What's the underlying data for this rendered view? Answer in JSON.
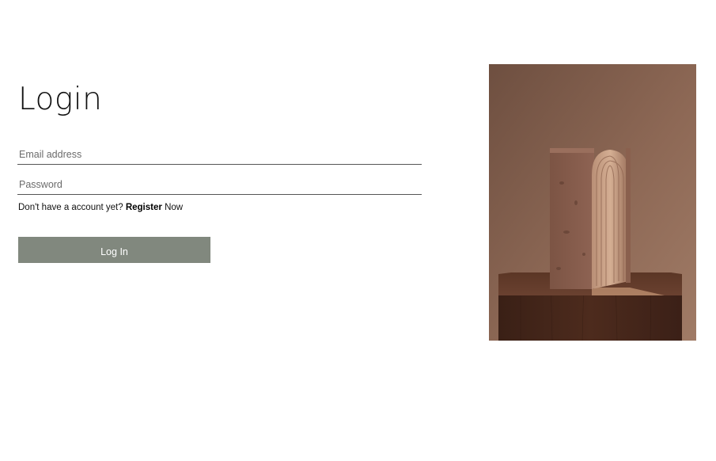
{
  "login": {
    "title": "Login",
    "email_placeholder": "Email address",
    "password_placeholder": "Password",
    "register_prompt": "Don't have a account yet?",
    "register_link": "Register",
    "register_suffix": "Now",
    "submit_label": "Log In"
  },
  "colors": {
    "button_background": "#81887e",
    "button_text": "#ffffff",
    "photo_wall": "#8a6452",
    "photo_pedestal": "#4a2b1e"
  }
}
